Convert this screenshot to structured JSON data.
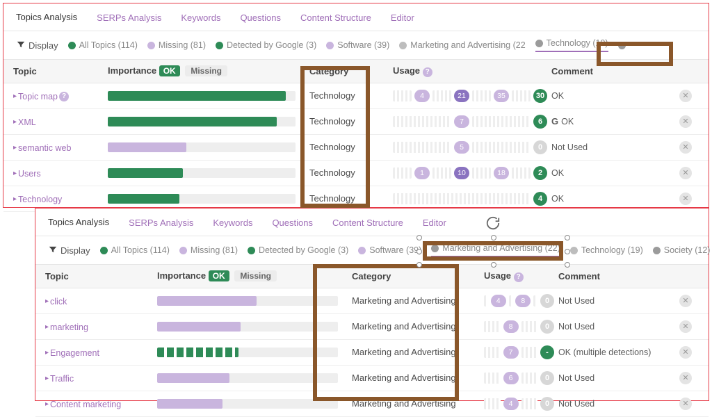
{
  "colors": {
    "green": "#2e8b57",
    "lilac": "#c9b5de",
    "purple": "#8a73c0",
    "grey": "#bdbdbd"
  },
  "tabs": [
    {
      "label": "Topics Analysis",
      "active": true
    },
    {
      "label": "SERPs Analysis"
    },
    {
      "label": "Keywords"
    },
    {
      "label": "Questions"
    },
    {
      "label": "Content Structure"
    },
    {
      "label": "Editor"
    }
  ],
  "display_label": "Display",
  "filter_groups": {
    "p1": [
      {
        "label": "All Topics (114)",
        "color": "#2e8b57"
      },
      {
        "label": "Missing (81)",
        "color": "#c9b5de"
      },
      {
        "label": "Detected by Google (3)",
        "color": "#2e8b57"
      },
      {
        "label": "Software (39)",
        "color": "#c9b5de"
      },
      {
        "label": "Marketing and Advertising (22)",
        "color": "#bdbdbd",
        "truncated": "Marketing and Advertising (22"
      },
      {
        "label": "Technology (19)",
        "color": "#9b9b9b",
        "active": true
      }
    ],
    "p2": [
      {
        "label": "All Topics (114)",
        "color": "#2e8b57"
      },
      {
        "label": "Missing (81)",
        "color": "#c9b5de"
      },
      {
        "label": "Detected by Google (3)",
        "color": "#2e8b57"
      },
      {
        "label": "Software (39)",
        "color": "#c9b5de"
      },
      {
        "label": "Marketing and Advertising (22)",
        "color": "#9b9b9b",
        "active": true
      },
      {
        "label": "Technology (19)",
        "color": "#bdbdbd"
      },
      {
        "label": "Society (12)",
        "color": "#9b9b9b"
      }
    ]
  },
  "headers": {
    "topic": "Topic",
    "importance": "Importance",
    "ok": "OK",
    "missing": "Missing",
    "category": "Category",
    "usage": "Usage",
    "comment": "Comment"
  },
  "p1_rows": [
    {
      "topic": "Topic map",
      "help": true,
      "imp_pct": 95,
      "imp_color": "#2e8b57",
      "category": "Technology",
      "usage": [
        {
          "n": "4",
          "bg": "#c9b5de"
        },
        {
          "n": "21",
          "bg": "#8a73c0"
        },
        {
          "n": "35",
          "bg": "#c9b5de"
        }
      ],
      "usage_end": {
        "n": "30",
        "bg": "#2e8b57"
      },
      "comment": "OK"
    },
    {
      "topic": "XML",
      "imp_pct": 90,
      "imp_color": "#2e8b57",
      "category": "Technology",
      "usage": [
        {
          "n": "7",
          "bg": "#c9b5de"
        }
      ],
      "usage_end": {
        "n": "6",
        "bg": "#2e8b57"
      },
      "google": true,
      "comment": "OK"
    },
    {
      "topic": "semantic web",
      "imp_pct": 42,
      "imp_color": "#c9b5de",
      "category": "Technology",
      "usage": [
        {
          "n": "5",
          "bg": "#c9b5de"
        }
      ],
      "usage_end": {
        "n": "0",
        "bg": "#d7d7d7"
      },
      "comment": "Not Used"
    },
    {
      "topic": "Users",
      "imp_pct": 40,
      "imp_color": "#2e8b57",
      "category": "Technology",
      "usage": [
        {
          "n": "1",
          "bg": "#c9b5de"
        },
        {
          "n": "10",
          "bg": "#8a73c0"
        },
        {
          "n": "18",
          "bg": "#c9b5de"
        }
      ],
      "usage_end": {
        "n": "2",
        "bg": "#2e8b57"
      },
      "comment": "OK"
    },
    {
      "topic": "Technology",
      "imp_pct": 38,
      "imp_color": "#2e8b57",
      "category": "Technology",
      "usage": [],
      "usage_end": {
        "n": "4",
        "bg": "#2e8b57"
      },
      "comment": "OK"
    }
  ],
  "p2_rows": [
    {
      "topic": "click",
      "imp_pct": 55,
      "imp_color": "#c9b5de",
      "category": "Marketing and Advertising",
      "usage": [
        {
          "n": "4",
          "bg": "#c9b5de"
        },
        {
          "n": "8",
          "bg": "#c9b5de"
        }
      ],
      "usage_end": {
        "n": "0",
        "bg": "#d7d7d7"
      },
      "comment": "Not Used"
    },
    {
      "topic": "marketing",
      "imp_pct": 46,
      "imp_color": "#c9b5de",
      "category": "Marketing and Advertising",
      "usage": [
        {
          "n": "8",
          "bg": "#c9b5de"
        }
      ],
      "usage_end": {
        "n": "0",
        "bg": "#d7d7d7"
      },
      "comment": "Not Used"
    },
    {
      "topic": "Engagement",
      "imp_pct": 45,
      "imp_color": "#2e8b57",
      "dashed": true,
      "category": "Marketing and Advertising",
      "usage": [
        {
          "n": "7",
          "bg": "#c9b5de"
        }
      ],
      "usage_end": {
        "n": "-",
        "bg": "#2e8b57"
      },
      "comment": "OK (multiple detections)"
    },
    {
      "topic": "Traffic",
      "imp_pct": 40,
      "imp_color": "#c9b5de",
      "category": "Marketing and Advertising",
      "usage": [
        {
          "n": "6",
          "bg": "#c9b5de"
        }
      ],
      "usage_end": {
        "n": "0",
        "bg": "#d7d7d7"
      },
      "comment": "Not Used"
    },
    {
      "topic": "Content marketing",
      "imp_pct": 36,
      "imp_color": "#c9b5de",
      "category": "Marketing and Advertising",
      "usage": [
        {
          "n": "4",
          "bg": "#c9b5de"
        }
      ],
      "usage_end": {
        "n": "0",
        "bg": "#d7d7d7"
      },
      "comment": "Not Used"
    }
  ]
}
